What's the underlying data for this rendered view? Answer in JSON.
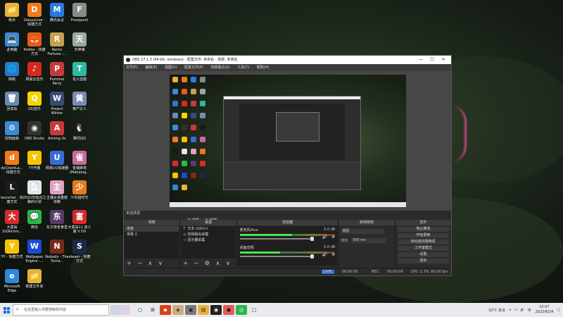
{
  "desktop": {
    "icons": [
      {
        "label": "杨月",
        "glyph": "📁",
        "bg": "#e8b23a"
      },
      {
        "label": "DouyuLive - 快捷方式",
        "glyph": "D",
        "bg": "#f27a1a"
      },
      {
        "label": "腾讯会议",
        "glyph": "M",
        "bg": "#2a7ae4"
      },
      {
        "label": "Frostpunk",
        "glyph": "F",
        "bg": "#8a8a8a"
      },
      {
        "label": "此电脑",
        "glyph": "💻",
        "bg": "#3a8ad6"
      },
      {
        "label": "firefox - 快捷方式",
        "glyph": "🦊",
        "bg": "#e85a1a"
      },
      {
        "label": "Rento Fortune -...",
        "glyph": "R",
        "bg": "#c8a050"
      },
      {
        "label": "天神镇",
        "glyph": "天",
        "bg": "#9aa8a0"
      },
      {
        "label": "网络",
        "glyph": "🌐",
        "bg": "#2a78c8"
      },
      {
        "label": "网易云音乐",
        "glyph": "♪",
        "bg": "#d6281e"
      },
      {
        "label": "Pummel Party",
        "glyph": "P",
        "bg": "#c83a3a"
      },
      {
        "label": "花火选题",
        "glyph": "T",
        "bg": "#2abba0"
      },
      {
        "label": "回收站",
        "glyph": "🗑",
        "bg": "#6a8ab0"
      },
      {
        "label": "QQ音乐",
        "glyph": "Q",
        "bg": "#f5d400"
      },
      {
        "label": "Project Winter",
        "glyph": "W",
        "bg": "#3a4a78"
      },
      {
        "label": "黄产达人",
        "glyph": "黄",
        "bg": "#7a8ab8"
      },
      {
        "label": "控制面板",
        "glyph": "⚙",
        "bg": "#3a8ad6"
      },
      {
        "label": "OBS Studio",
        "glyph": "◉",
        "bg": "#333333"
      },
      {
        "label": "Among Us",
        "glyph": "A",
        "bg": "#c83a3a"
      },
      {
        "label": "腾讯QQ",
        "glyph": "🐧",
        "bg": "#1a1a1a"
      },
      {
        "label": "dyClientLa... - 快捷方式",
        "glyph": "d",
        "bg": "#f27a1a"
      },
      {
        "label": "YY开播",
        "glyph": "Y",
        "bg": "#f5c400"
      },
      {
        "label": "网易UU加速器",
        "glyph": "U",
        "bg": "#3a6ad6"
      },
      {
        "label": "雀魂麻将 (Mahjong...",
        "glyph": "雀",
        "bg": "#c86a9a"
      },
      {
        "label": "launcher - 快捷方式",
        "glyph": "L",
        "bg": "#1a1a1a"
      },
      {
        "label": "2022年综合之路的计划",
        "glyph": "📄",
        "bg": "#e6e6e6"
      },
      {
        "label": "主播女孩重度依赖",
        "glyph": "主",
        "bg": "#e0a0c0"
      },
      {
        "label": "少石猎时光",
        "glyph": "少",
        "bg": "#e87a1a"
      },
      {
        "label": "大富翁10(Richm...",
        "glyph": "大",
        "bg": "#d62a2a"
      },
      {
        "label": "微信",
        "glyph": "💬",
        "bg": "#2ab84a"
      },
      {
        "label": "东方夜雀食堂",
        "glyph": "东",
        "bg": "#5a3a6a"
      },
      {
        "label": "大富翁11 双人版 V DX",
        "glyph": "富",
        "bg": "#d62a2a"
      },
      {
        "label": "YY - 快捷方式",
        "glyph": "Y",
        "bg": "#f5c400"
      },
      {
        "label": "Wallpaper Engine -...",
        "glyph": "W",
        "bg": "#1a4ad6"
      },
      {
        "label": "Nobody - The Turna...",
        "glyph": "N",
        "bg": "#7a2a1a"
      },
      {
        "label": "steam - 快捷方式",
        "glyph": "S",
        "bg": "#1a2a4a"
      },
      {
        "label": "Microsoft Edge",
        "glyph": "e",
        "bg": "#2a8ad6"
      },
      {
        "label": "新建文件夹",
        "glyph": "📁",
        "bg": "#e8b23a"
      }
    ]
  },
  "obs": {
    "title": "OBS 27.1.3 (64-bit, windows) - 配置文件: 未命名 - 场景: 未命名",
    "window_buttons": [
      "—",
      "☐",
      "✕"
    ],
    "menu": [
      "文件(F)",
      "编辑(E)",
      "视图(V)",
      "配置文件(P)",
      "场景集合(S)",
      "工具(T)",
      "帮助(H)"
    ],
    "no_source_selected": "未选择源",
    "toolbar": {
      "properties": "属性",
      "filters": "滤镜"
    },
    "docks": {
      "scenes": {
        "title": "场景",
        "items": [
          "场景",
          "场景 2"
        ],
        "footer": "+ − ∧ ∨"
      },
      "sources": {
        "title": "来源",
        "items": [
          {
            "icon": "T",
            "name": "文本 (GDI+)"
          },
          {
            "icon": "◎",
            "name": "音频输出采集"
          },
          {
            "icon": "▭",
            "name": "显示器采集"
          }
        ],
        "footer": "+ − ⚙ ∧ ∨"
      },
      "mixer": {
        "title": "混音器",
        "channels": [
          {
            "name": "麦克风/Aux",
            "value": "0.0 dB",
            "level": 0.55
          },
          {
            "name": "桌面音频",
            "value": "0.0 dB",
            "level": 0.42
          }
        ]
      },
      "transitions": {
        "title": "转场特效",
        "type": "渐隐",
        "duration_label": "时长",
        "duration": "300 ms"
      },
      "controls": {
        "title": "控件",
        "buttons": [
          "停止推流",
          "开始录制",
          "启动虚拟摄像机",
          "工作室模式",
          "设置",
          "退出"
        ]
      }
    },
    "status": {
      "live_badge": "LIVE:",
      "live_time": "00:00:00",
      "rec_badge": "REC:",
      "rec_time": "00:00:00",
      "cpu": "CPU: 2.3%, 60.00 fps"
    }
  },
  "taskbar": {
    "search_placeholder": "在这里输入你要搜索的内容",
    "tray": {
      "weather": "32°C 多云",
      "ime": "中",
      "time": "15:07",
      "date": "2022/6/24"
    }
  },
  "colors": {
    "obs_bg": "#2b2b2b",
    "taskbar_bg": "#e9eaee",
    "meter_green": "#4ee14e",
    "accent_pink": "#d64a8a"
  }
}
